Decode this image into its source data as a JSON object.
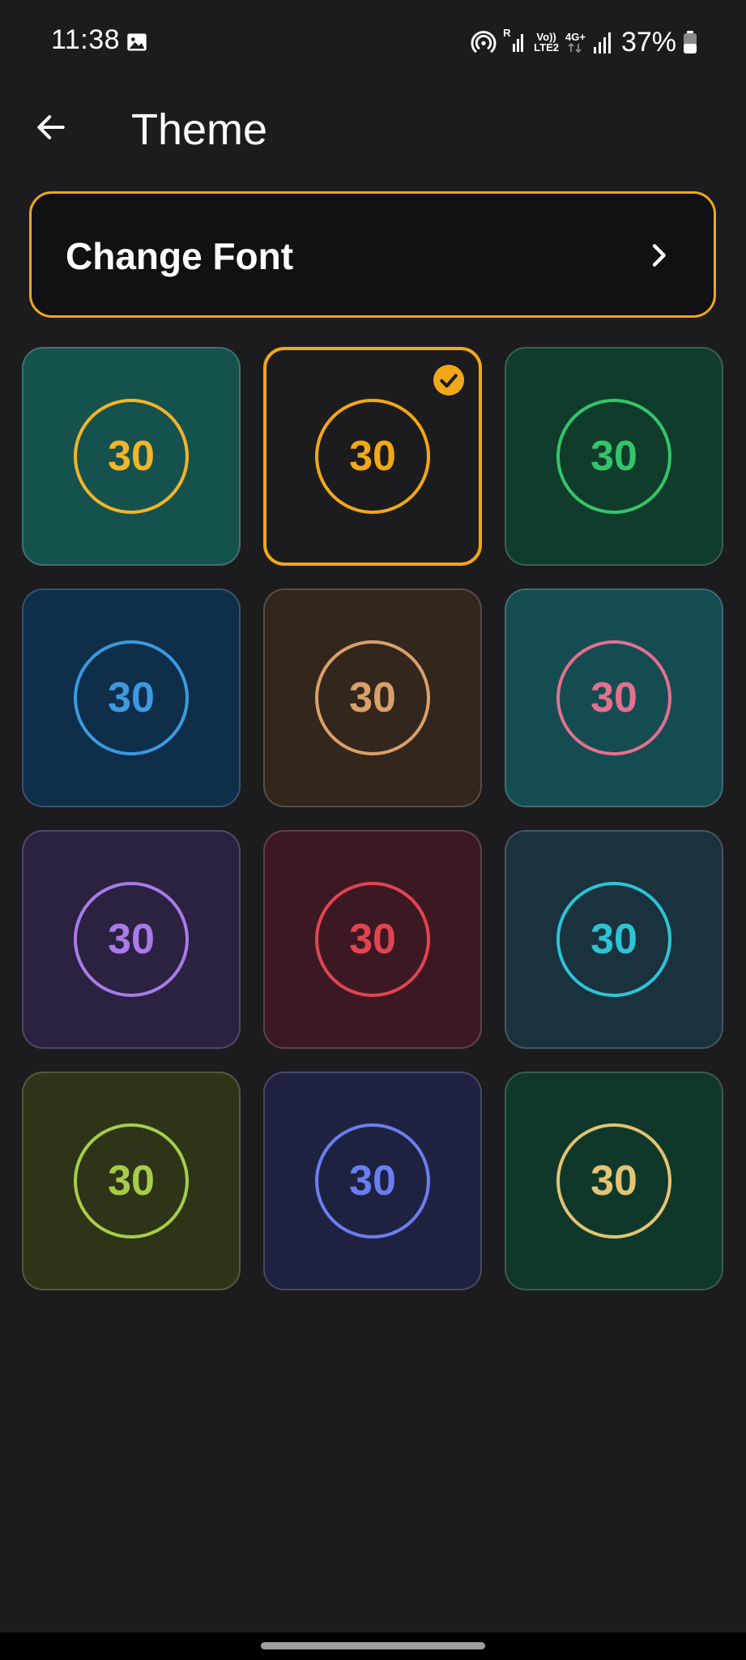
{
  "status_bar": {
    "time": "11:38",
    "icons": [
      "gallery-icon",
      "hotspot-icon",
      "signal-r-icon",
      "volte-icon",
      "data-4g-icon",
      "signal-icon",
      "battery-icon"
    ],
    "volte_top": "Vo))",
    "volte_bottom": "LTE2",
    "network": "4G+",
    "roaming": "R",
    "battery": "37%"
  },
  "app_bar": {
    "title": "Theme",
    "back_icon": "arrow-left-icon"
  },
  "change_font": {
    "label": "Change Font",
    "icon": "chevron-right-icon",
    "accent": "#f0a818"
  },
  "themes": [
    {
      "value": "30",
      "bg": "#16524d",
      "accent": "#f0b52a",
      "selected": false
    },
    {
      "value": "30",
      "bg": "#1c1c1e",
      "accent": "#f0a818",
      "selected": true
    },
    {
      "value": "30",
      "bg": "#103c2c",
      "accent": "#34c46a",
      "selected": false
    },
    {
      "value": "30",
      "bg": "#0e2e4a",
      "accent": "#3b9ae0",
      "selected": false
    },
    {
      "value": "30",
      "bg": "#33261d",
      "accent": "#d9a06a",
      "selected": false
    },
    {
      "value": "30",
      "bg": "#154c52",
      "accent": "#e2708e",
      "selected": false
    },
    {
      "value": "30",
      "bg": "#2b2140",
      "accent": "#a97ae8",
      "selected": false
    },
    {
      "value": "30",
      "bg": "#3c1922",
      "accent": "#e04452",
      "selected": false
    },
    {
      "value": "30",
      "bg": "#1a323e",
      "accent": "#2cc4d4",
      "selected": false
    },
    {
      "value": "30",
      "bg": "#2e3417",
      "accent": "#a8cc4a",
      "selected": false
    },
    {
      "value": "30",
      "bg": "#1e2240",
      "accent": "#6a7ef0",
      "selected": false
    },
    {
      "value": "30",
      "bg": "#10382a",
      "accent": "#e2c474",
      "selected": false
    }
  ]
}
